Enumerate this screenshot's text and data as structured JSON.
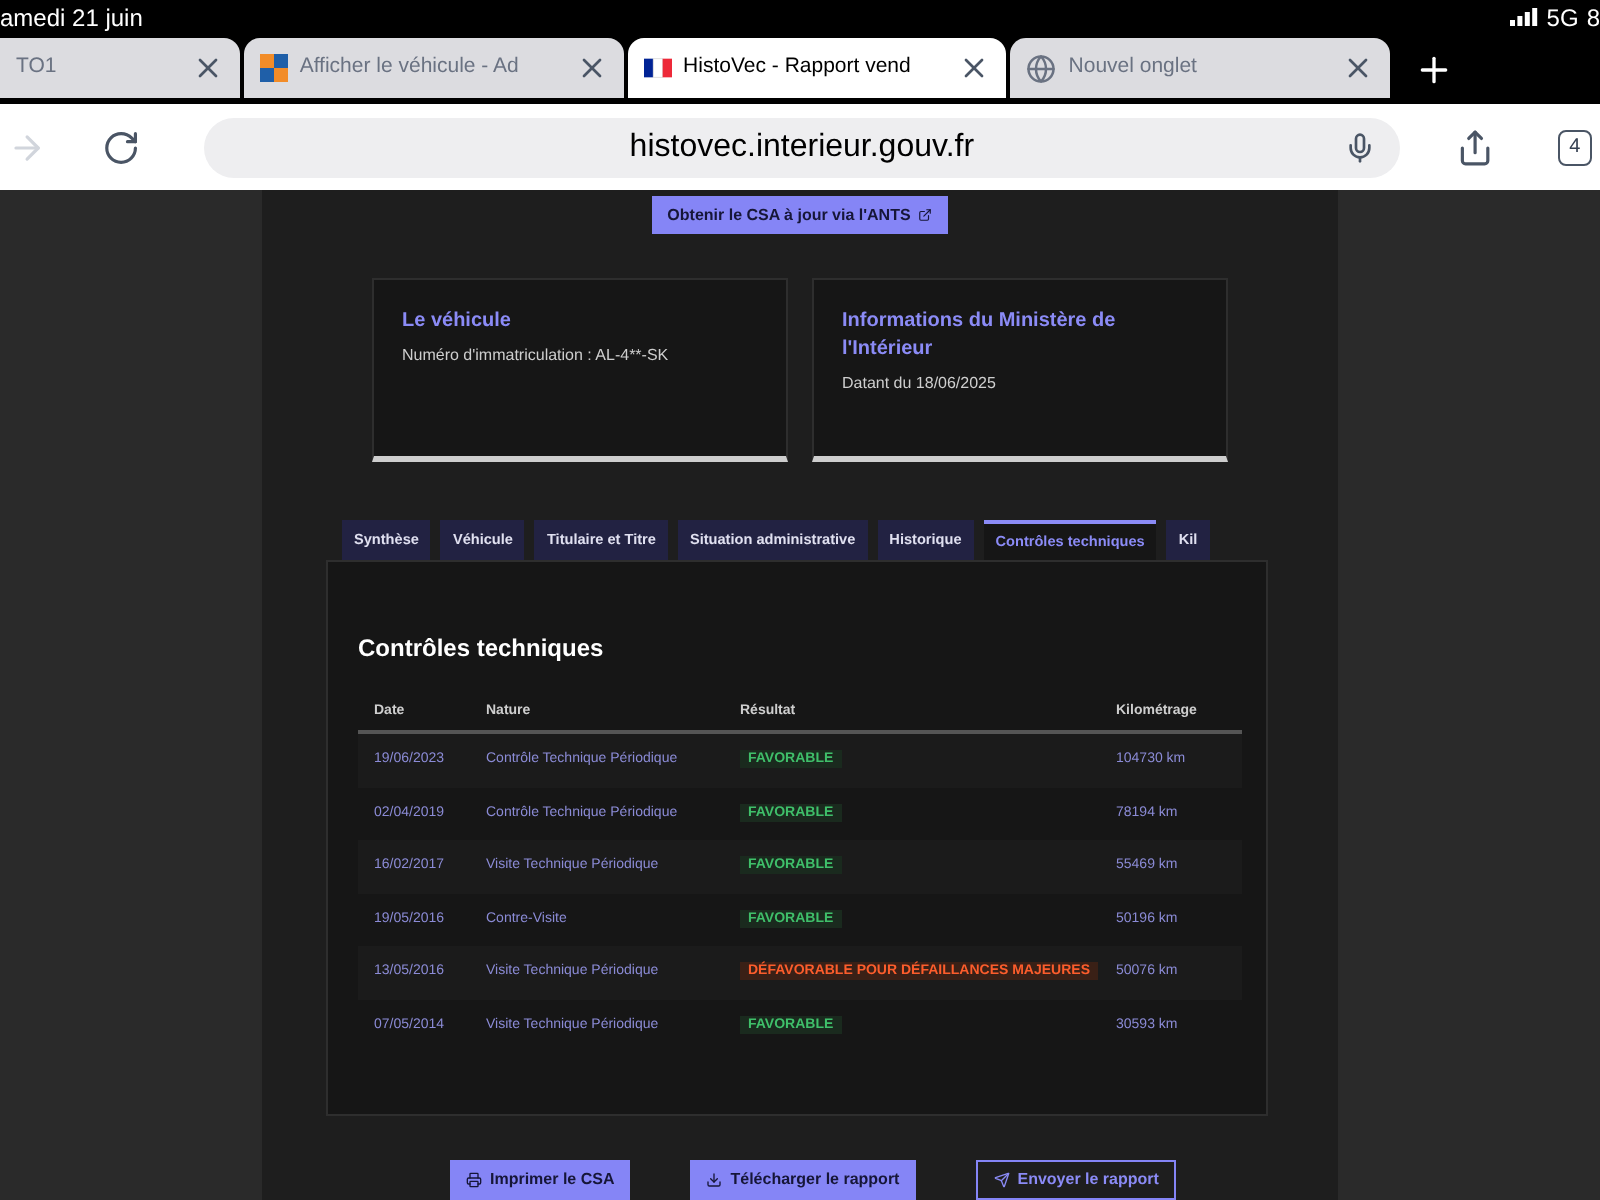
{
  "status_bar": {
    "date": "amedi 21 juin",
    "network": "5G",
    "battery": "8"
  },
  "browser_tabs": [
    {
      "title": "TO1",
      "selected": false
    },
    {
      "title": "Afficher le véhicule - Ad",
      "selected": false
    },
    {
      "title": "HistoVec - Rapport vend",
      "selected": true
    },
    {
      "title": "Nouvel onglet",
      "selected": false
    }
  ],
  "address_bar": {
    "url": "histovec.interieur.gouv.fr",
    "tab_count": "4"
  },
  "csa_button": "Obtenir le CSA à jour via l'ANTS",
  "cards": [
    {
      "title": "Le véhicule",
      "text": "Numéro d'immatriculation : AL-4**-SK"
    },
    {
      "title": "Informations du Ministère de l'Intérieur",
      "text": "Datant du 18/06/2025"
    }
  ],
  "tabs": [
    {
      "label": "Synthèse",
      "selected": false
    },
    {
      "label": "Véhicule",
      "selected": false
    },
    {
      "label": "Titulaire et Titre",
      "selected": false
    },
    {
      "label": "Situation administrative",
      "selected": false
    },
    {
      "label": "Historique",
      "selected": false
    },
    {
      "label": "Contrôles techniques",
      "selected": true
    },
    {
      "label": "Kil",
      "selected": false
    }
  ],
  "section_title": "Contrôles techniques",
  "table": {
    "columns": [
      "Date",
      "Nature",
      "Résultat",
      "Kilométrage"
    ],
    "rows": [
      {
        "date": "19/06/2023",
        "nature": "Contrôle Technique Périodique",
        "result": "FAVORABLE",
        "kind": "favorable",
        "km": "104730 km"
      },
      {
        "date": "02/04/2019",
        "nature": "Contrôle Technique Périodique",
        "result": "FAVORABLE",
        "kind": "favorable",
        "km": "78194 km"
      },
      {
        "date": "16/02/2017",
        "nature": "Visite Technique Périodique",
        "result": "FAVORABLE",
        "kind": "favorable",
        "km": "55469 km"
      },
      {
        "date": "19/05/2016",
        "nature": "Contre-Visite",
        "result": "FAVORABLE",
        "kind": "favorable",
        "km": "50196 km"
      },
      {
        "date": "13/05/2016",
        "nature": "Visite Technique Périodique",
        "result": "DÉFAVORABLE POUR DÉFAILLANCES MAJEURES",
        "kind": "unfavorable",
        "km": "50076 km"
      },
      {
        "date": "07/05/2014",
        "nature": "Visite Technique Périodique",
        "result": "FAVORABLE",
        "kind": "favorable",
        "km": "30593 km"
      }
    ]
  },
  "actions": [
    {
      "label": "Imprimer le CSA",
      "kind": "primary"
    },
    {
      "label": "Télécharger le rapport",
      "kind": "primary"
    },
    {
      "label": "Envoyer le rapport",
      "kind": "outline"
    }
  ]
}
